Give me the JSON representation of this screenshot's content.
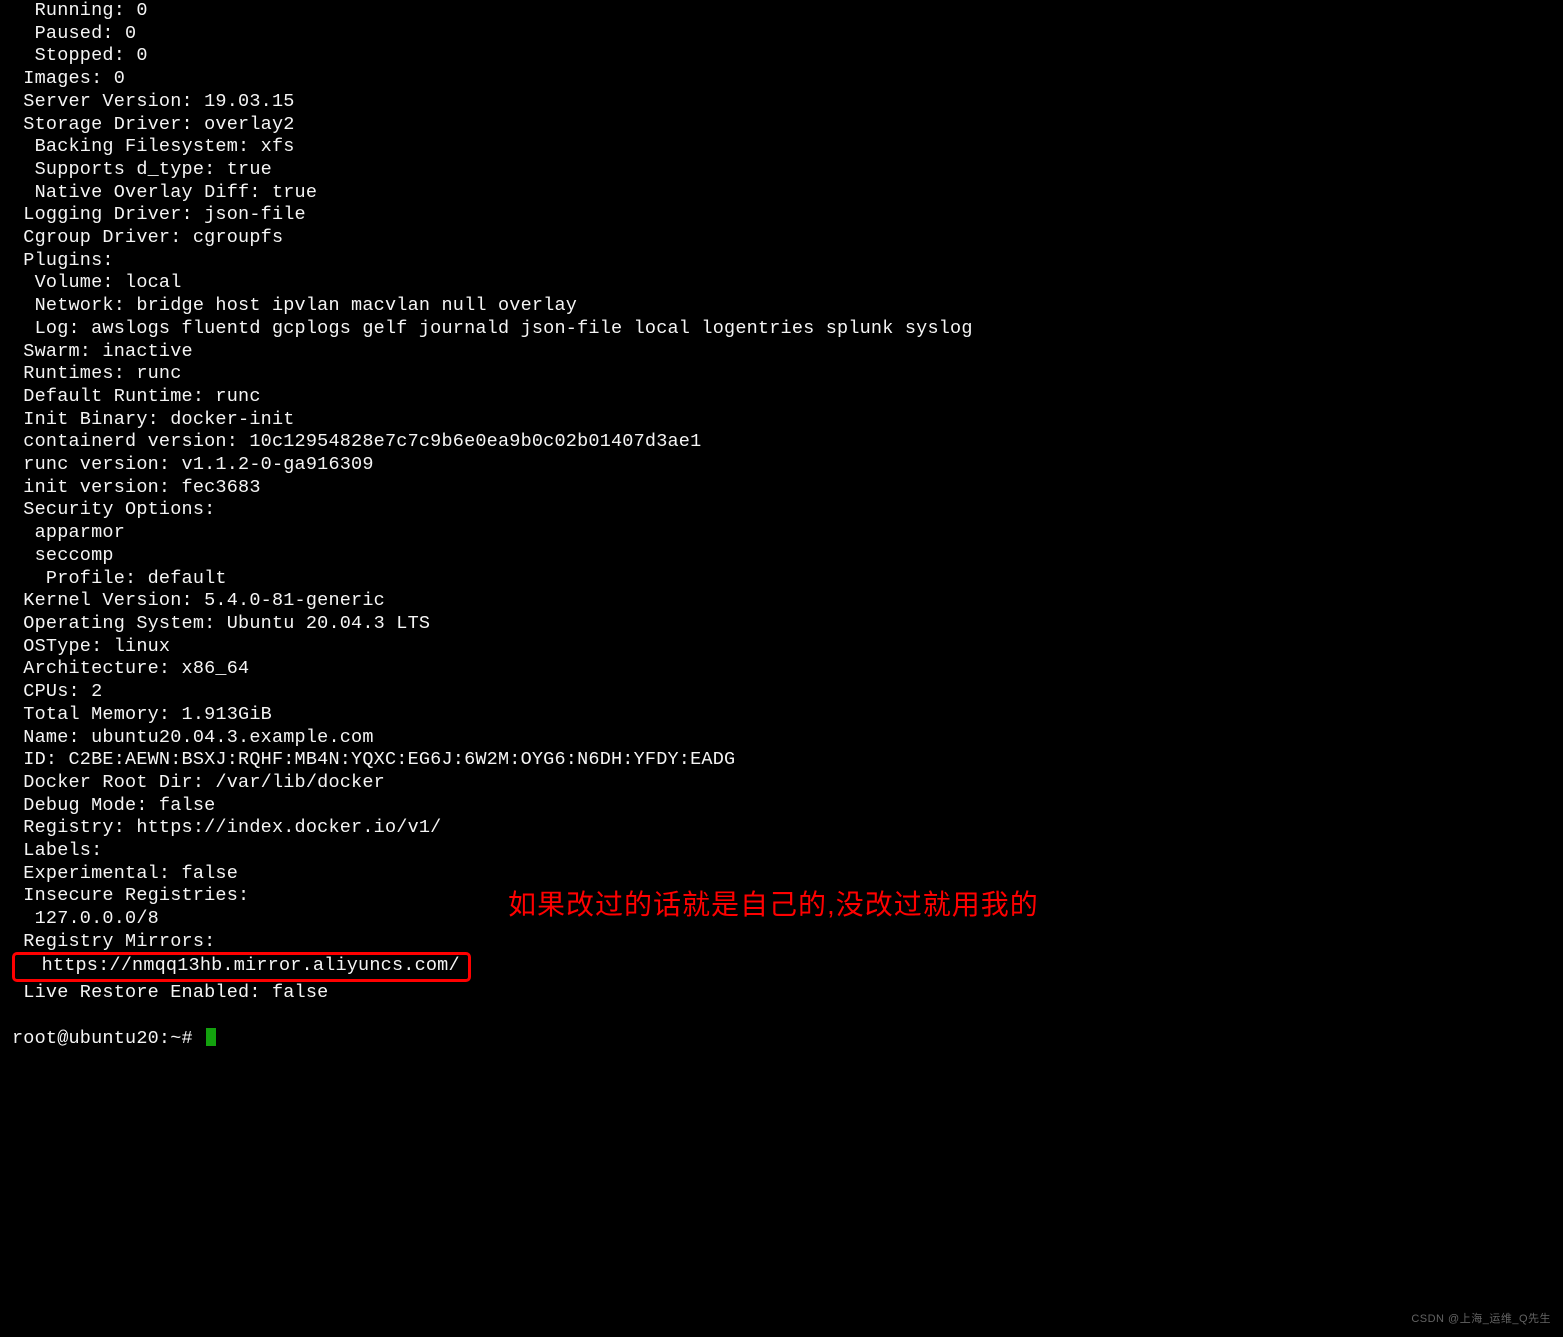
{
  "lines": [
    "  Running: 0",
    "  Paused: 0",
    "  Stopped: 0",
    " Images: 0",
    " Server Version: 19.03.15",
    " Storage Driver: overlay2",
    "  Backing Filesystem: xfs",
    "  Supports d_type: true",
    "  Native Overlay Diff: true",
    " Logging Driver: json-file",
    " Cgroup Driver: cgroupfs",
    " Plugins:",
    "  Volume: local",
    "  Network: bridge host ipvlan macvlan null overlay",
    "  Log: awslogs fluentd gcplogs gelf journald json-file local logentries splunk syslog",
    " Swarm: inactive",
    " Runtimes: runc",
    " Default Runtime: runc",
    " Init Binary: docker-init",
    " containerd version: 10c12954828e7c7c9b6e0ea9b0c02b01407d3ae1",
    " runc version: v1.1.2-0-ga916309",
    " init version: fec3683",
    " Security Options:",
    "  apparmor",
    "  seccomp",
    "   Profile: default",
    " Kernel Version: 5.4.0-81-generic",
    " Operating System: Ubuntu 20.04.3 LTS",
    " OSType: linux",
    " Architecture: x86_64",
    " CPUs: 2",
    " Total Memory: 1.913GiB",
    " Name: ubuntu20.04.3.example.com",
    " ID: C2BE:AEWN:BSXJ:RQHF:MB4N:YQXC:EG6J:6W2M:OYG6:N6DH:YFDY:EADG",
    " Docker Root Dir: /var/lib/docker",
    " Debug Mode: false",
    " Registry: https://index.docker.io/v1/",
    " Labels:",
    " Experimental: false",
    " Insecure Registries:",
    "  127.0.0.0/8",
    " Registry Mirrors:",
    " Live Restore Enabled: false"
  ],
  "mirror_line": "  https://nmqq13hb.mirror.aliyuncs.com/",
  "prompt": "root@ubuntu20:~# ",
  "annotation": "如果改过的话就是自己的,没改过就用我的",
  "watermark": "CSDN @上海_运维_Q先生"
}
